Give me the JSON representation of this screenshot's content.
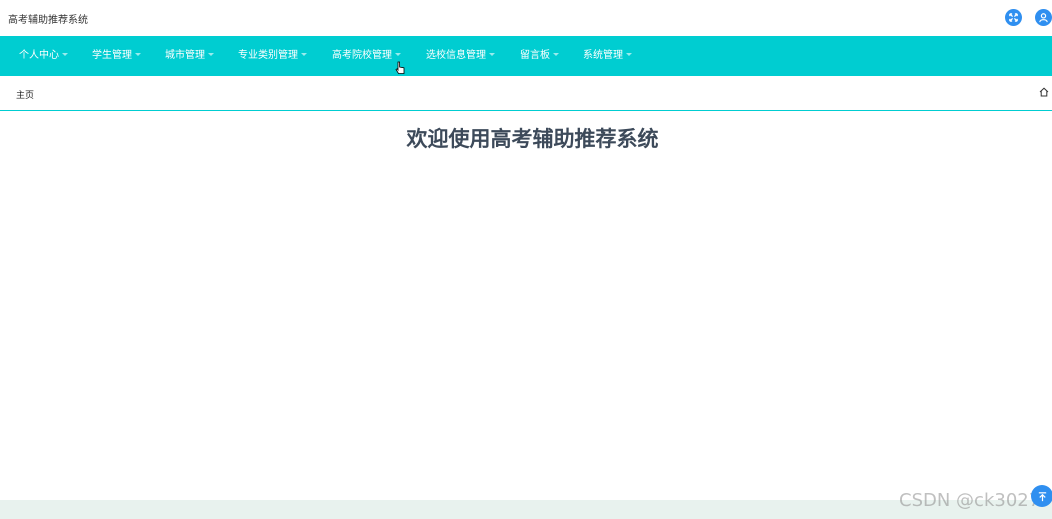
{
  "app": {
    "title": "高考辅助推荐系统"
  },
  "header": {
    "icons": [
      "fullscreen-icon",
      "user-icon"
    ],
    "icon_color": "#2f8ff0"
  },
  "nav": {
    "bg_color": "#00cdd1",
    "items": [
      {
        "label": "个人中心"
      },
      {
        "label": "学生管理"
      },
      {
        "label": "城市管理"
      },
      {
        "label": "专业类别管理"
      },
      {
        "label": "高考院校管理"
      },
      {
        "label": "选校信息管理"
      },
      {
        "label": "留言板"
      },
      {
        "label": "系统管理"
      }
    ]
  },
  "breadcrumb": {
    "current": "主页",
    "icon": "home-icon"
  },
  "main": {
    "welcome": "欢迎使用高考辅助推荐系统"
  },
  "watermark": "CSDN @ck3027",
  "float_button": {
    "icon": "back-to-top-icon"
  }
}
